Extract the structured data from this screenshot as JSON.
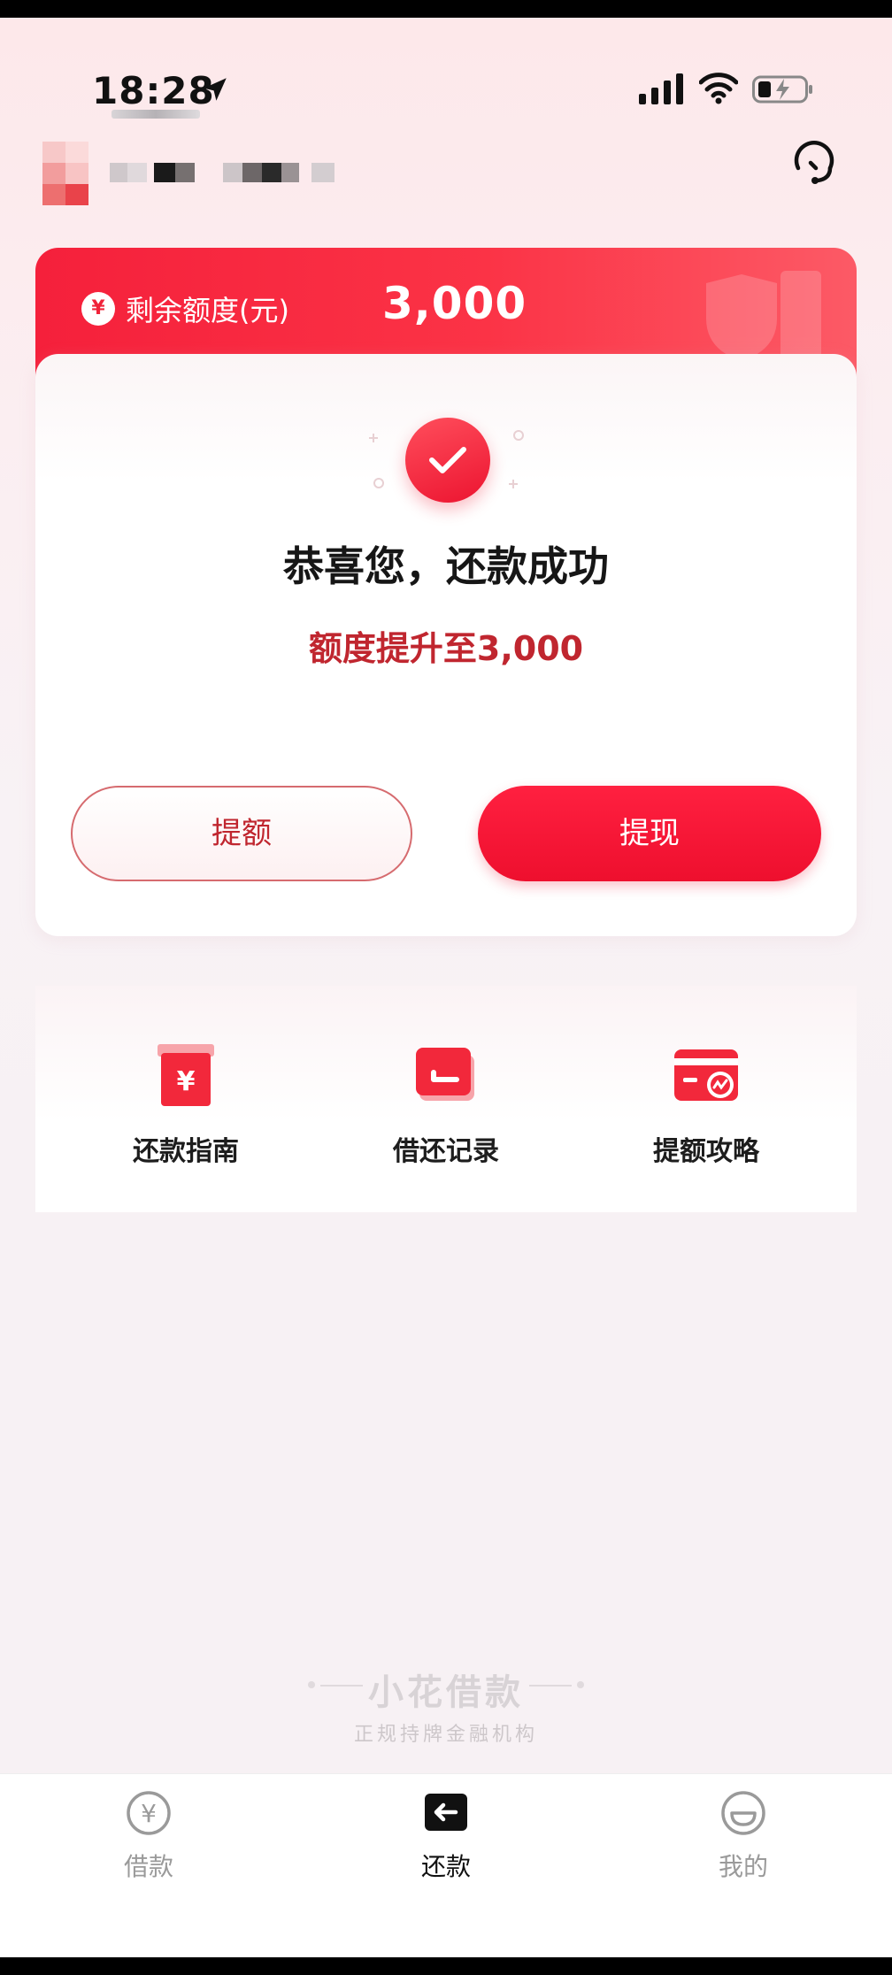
{
  "status_bar": {
    "time": "18:28"
  },
  "credit": {
    "currency_icon": "¥",
    "label": "剩余额度(元)",
    "value": "3,000"
  },
  "success": {
    "title": "恭喜您，还款成功",
    "subtitle": "额度提升至3,000",
    "btn_raise": "提额",
    "btn_withdraw": "提现"
  },
  "quick_actions": [
    {
      "label": "还款指南",
      "icon": "repayment-guide-icon"
    },
    {
      "label": "借还记录",
      "icon": "loan-history-icon"
    },
    {
      "label": "提额攻略",
      "icon": "credit-raise-tips-icon"
    }
  ],
  "brand": {
    "name": "小花借款",
    "tagline": "正规持牌金融机构"
  },
  "tabs": [
    {
      "label": "借款",
      "icon": "yuan-circle-icon",
      "active": false
    },
    {
      "label": "还款",
      "icon": "back-arrow-box-icon",
      "active": true
    },
    {
      "label": "我的",
      "icon": "smile-face-icon",
      "active": false
    }
  ],
  "colors": {
    "primary_red": "#ee0f2e",
    "dark_red_text": "#c0262f",
    "page_bg": "#f7f1f4"
  }
}
